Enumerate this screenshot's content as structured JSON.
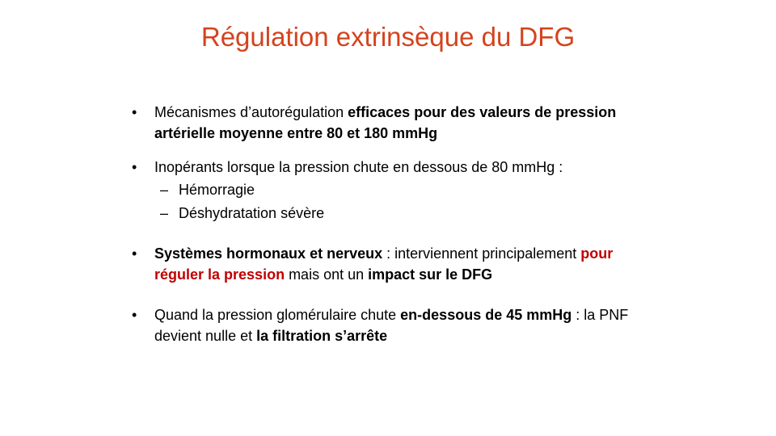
{
  "title": "Régulation extrinsèque du DFG",
  "colors": {
    "title": "#d4431d",
    "highlight": "#c00000"
  },
  "bullets": [
    {
      "marker": "•",
      "segments": [
        "Mécanismes d’autorégulation ",
        "efficaces pour des valeurs de pression artérielle moyenne entre 80 et 180 mmHg"
      ]
    },
    {
      "marker": "•",
      "segments": [
        "Inopérants lorsque la pression chute en dessous de 80 mmHg :"
      ],
      "sub_items": [
        {
          "marker": "–",
          "text": "Hémorragie"
        },
        {
          "marker": "–",
          "text": "Déshydratation sévère"
        }
      ]
    },
    {
      "marker": "•",
      "segments": [
        "Systèmes hormonaux et nerveux",
        " : interviennent principalement ",
        "pour réguler la pression",
        " mais ont un ",
        "impact sur le DFG"
      ]
    },
    {
      "marker": "•",
      "segments": [
        "Quand la pression glomérulaire chute ",
        "en-dessous de 45 mmHg",
        " : la PNF devient nulle et ",
        "la filtration s’arrête"
      ]
    }
  ]
}
